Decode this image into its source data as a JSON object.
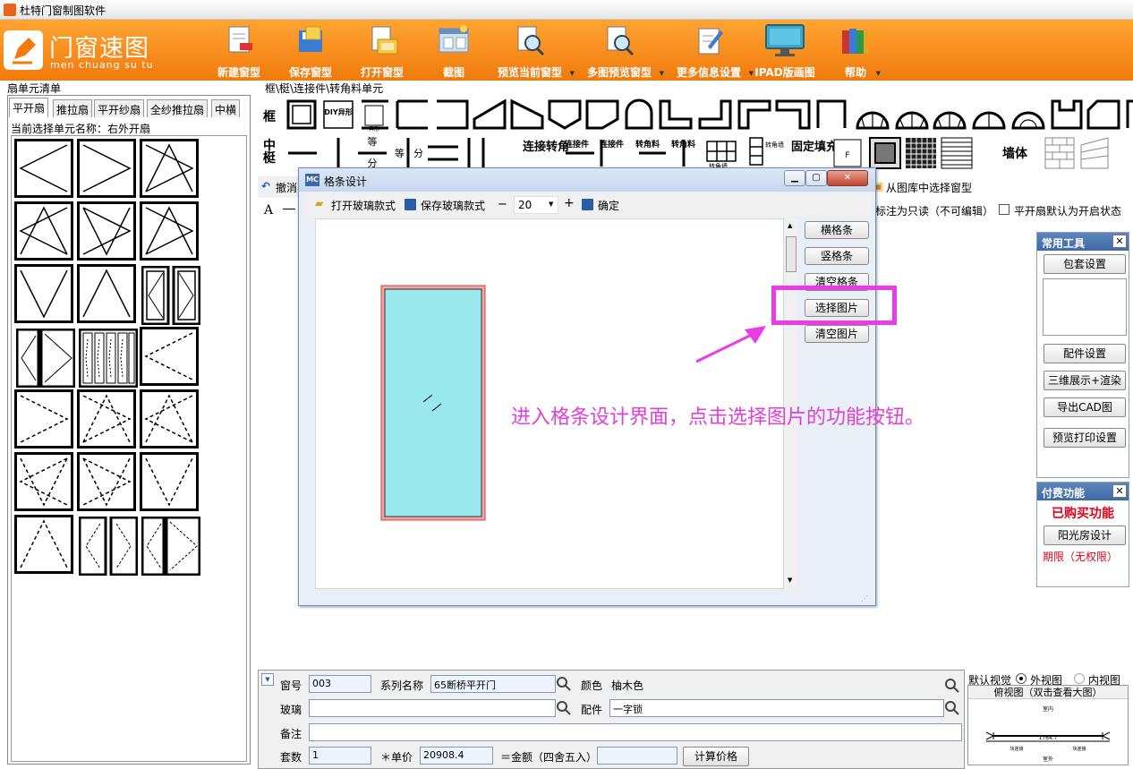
{
  "window": {
    "title": "杜特门窗制图软件"
  },
  "logo": {
    "name": "门窗速图",
    "pinyin": "men chuang su tu"
  },
  "toolbar": {
    "items": [
      {
        "label": "新建窗型",
        "icon": "new-document-icon"
      },
      {
        "label": "保存窗型",
        "icon": "save-icon"
      },
      {
        "label": "打开窗型",
        "icon": "open-file-icon"
      },
      {
        "label": "截图",
        "icon": "screenshot-icon"
      },
      {
        "label": "预览当前窗型",
        "icon": "preview-icon"
      },
      {
        "label": "多图预览窗型",
        "icon": "multi-preview-icon"
      },
      {
        "label": "更多信息设置",
        "icon": "settings-form-icon"
      },
      {
        "label": "IPAD版画图",
        "icon": "ipad-icon"
      },
      {
        "label": "帮助",
        "icon": "help-books-icon"
      }
    ]
  },
  "left": {
    "title": "扇单元清单",
    "tabs": [
      "平开扇",
      "推拉扇",
      "平开纱扇",
      "全纱推拉扇",
      "中横"
    ],
    "current_label": "当前选择单元名称：右外开扇"
  },
  "parts": {
    "title": "框\\梃\\连接件\\转角料单元",
    "row1_label": "框",
    "row2_label": "中梃",
    "diy_label": "DIY异形",
    "ydan_label": "异形",
    "fen_top": "等",
    "fen_bottom": "分",
    "fen2a": "等",
    "fen2b": "分",
    "lianjie_zhuanjiao": "连接转角",
    "lianjiejian": "连接件",
    "lianjiejian2": "连接件",
    "zhuanjiaoliao": "转角料",
    "zhuanjiaoliao2": "转角料",
    "zhuanjiaoqiang": "转角墙",
    "zhuanjiaoqiang2": "转角墙",
    "guding_tianchong": "固定填充",
    "f_label": "F",
    "wall_label": "墙体"
  },
  "editbar": {
    "undo_label": "撤消",
    "from_lib_label": "从图库中选择窗型",
    "font_label": "A",
    "readonly_label": "标注为只读（不可编辑）",
    "default_open_label": "平开扇默认为开启状态"
  },
  "dialog": {
    "title": "格条设计",
    "icon_label": "MC",
    "open_style": "打开玻璃款式",
    "save_style": "保存玻璃款式",
    "minus": "−",
    "size_value": "20",
    "plus": "+",
    "confirm": "确定",
    "buttons": [
      "横格条",
      "竖格条",
      "清空格条",
      "选择图片",
      "清空图片"
    ]
  },
  "annotation": {
    "text": "进入格条设计界面，点击选择图片的功能按钮。",
    "color": "#e040d8"
  },
  "right_panel": {
    "tools_title": "常用工具",
    "tools": [
      "包套设置",
      "配件设置",
      "三维展示+渲染",
      "导出CAD图",
      "预览打印设置"
    ],
    "paid_title": "付费功能",
    "purchased": "已购买功能",
    "sunroom": "阳光房设计",
    "term": "期限（无权限）"
  },
  "bottom": {
    "window_no_label": "窗号",
    "window_no": "003",
    "series_label": "系列名称",
    "series": "65断桥平开门",
    "color_label": "颜色",
    "color": "柚木色",
    "glass_label": "玻璃",
    "glass": "",
    "fittings_label": "配件",
    "fittings": "一字锁",
    "note_label": "备注",
    "note": "",
    "sets_label": "套数",
    "sets": "1",
    "unit_price_label": "＊单价",
    "unit_price": "20908.4",
    "amount_label": "＝金额（四舍五入）",
    "amount": "",
    "calc_button": "计算价格",
    "view_label": "默认视觉",
    "outer_view": "外视图",
    "inner_view": "内视图",
    "plan_view_label": "俯视图（双击查看大图）",
    "plan_top": "室内",
    "plan_bottom": "室外",
    "plan_dim": "1764.7",
    "plan_l": "块连接",
    "plan_r": "块连接"
  }
}
